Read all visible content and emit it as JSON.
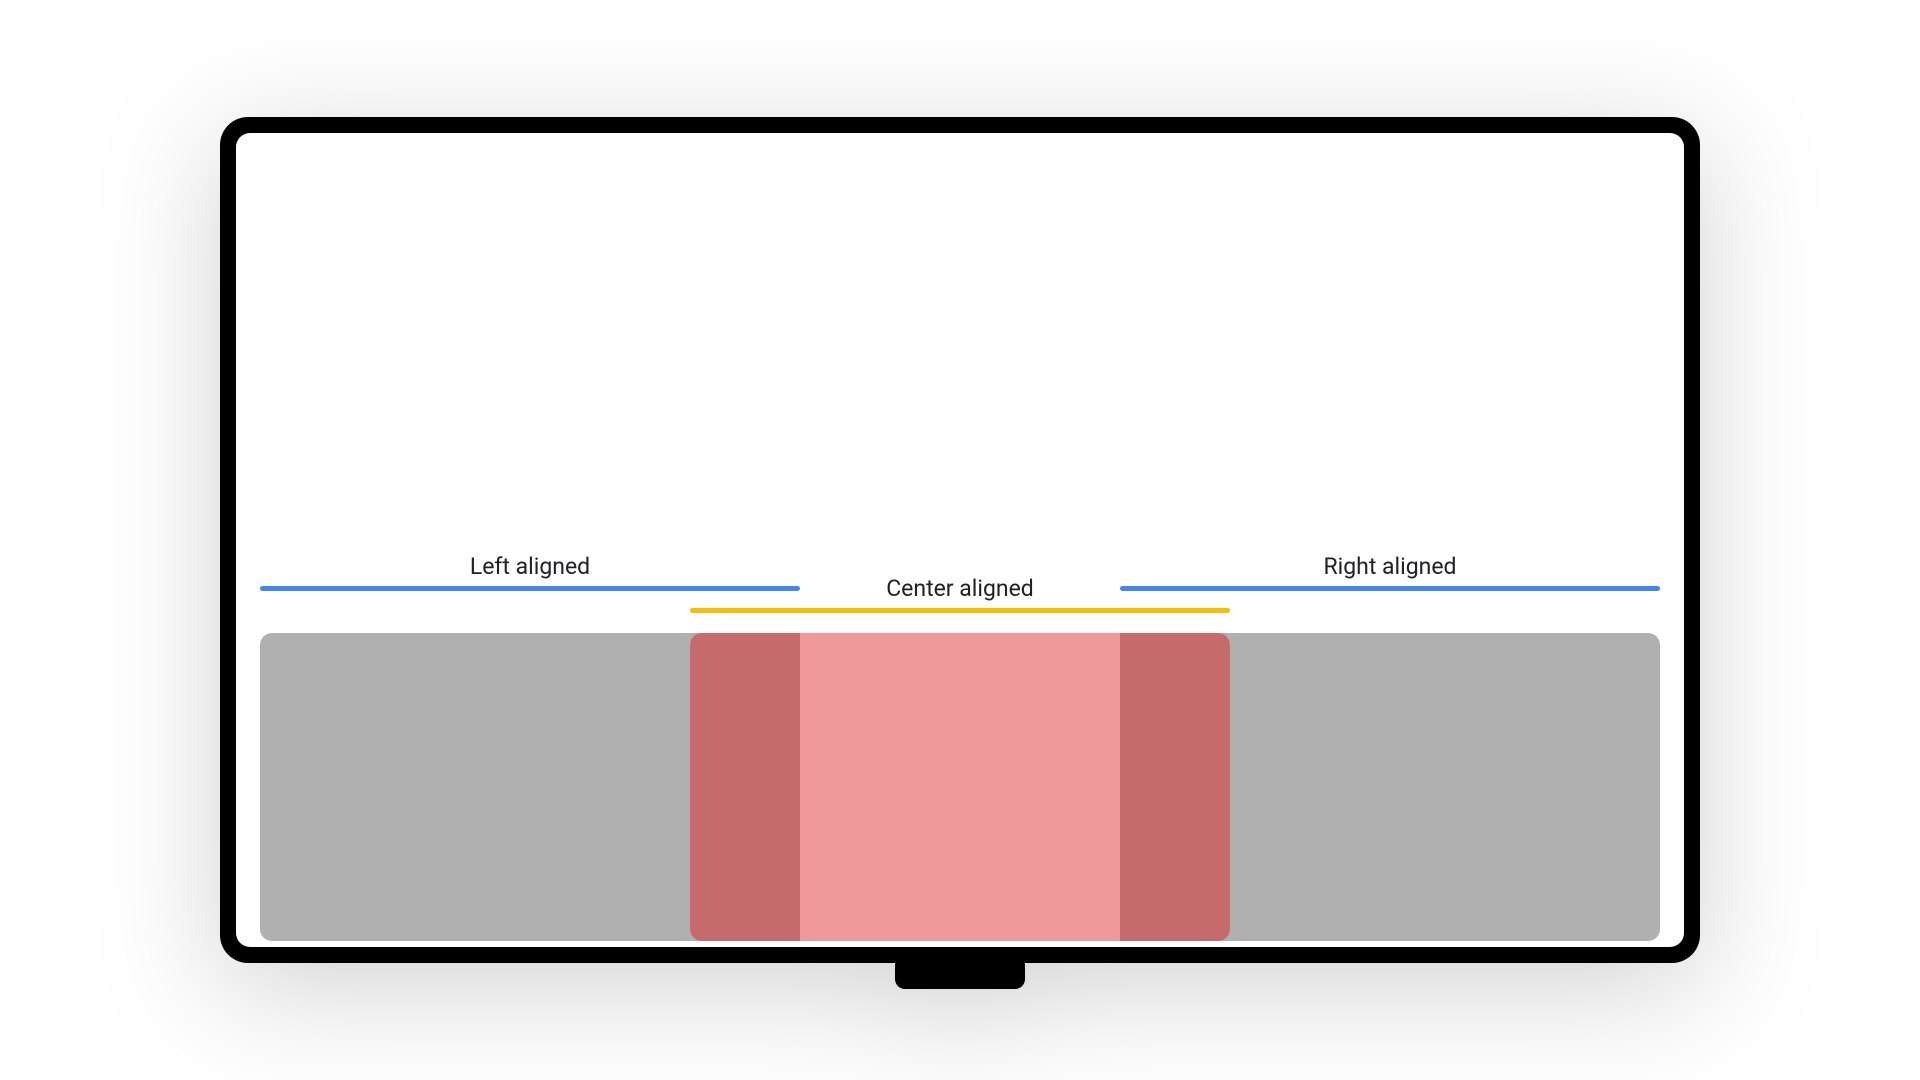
{
  "diagram": {
    "labels": {
      "left": "Left aligned",
      "center": "Center aligned",
      "right": "Right aligned"
    },
    "colors": {
      "line_blue": "#4285F4",
      "line_yellow": "#FBBC04",
      "block_gray": "#B0B0B0",
      "block_light_red": "#EF9A9A",
      "block_dark_red": "#C66B6B"
    }
  }
}
